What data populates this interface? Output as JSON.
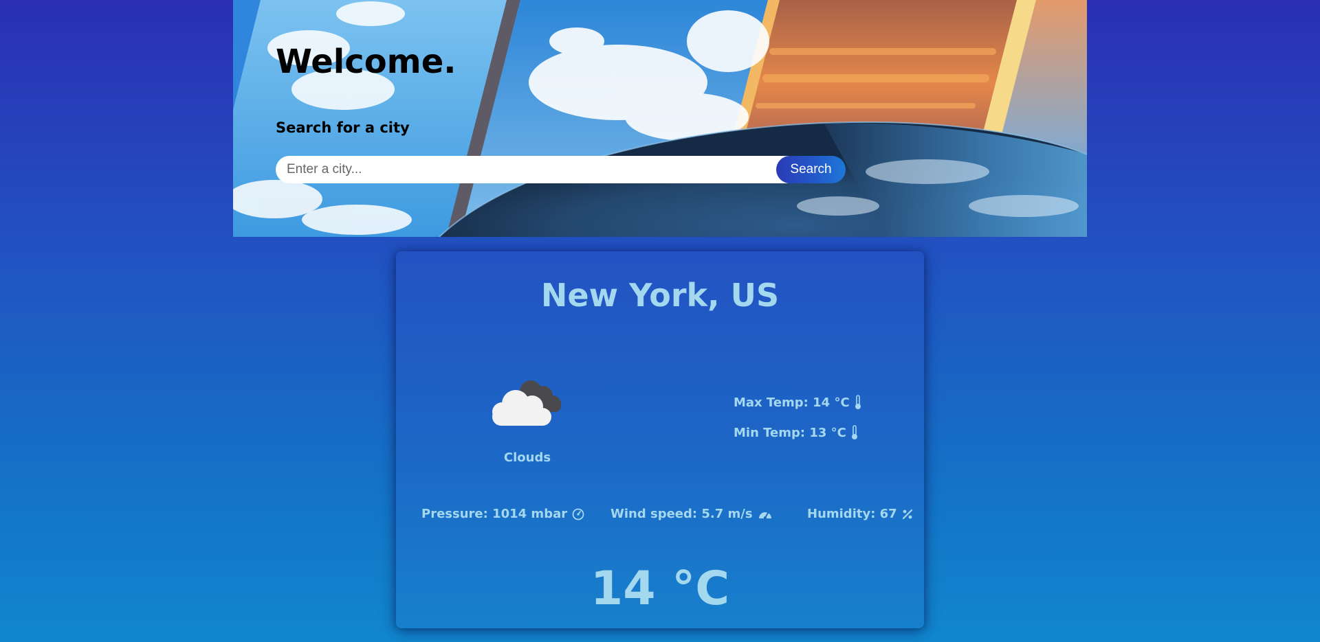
{
  "hero": {
    "welcome": "Welcome.",
    "search_label": "Search for a city",
    "search_placeholder": "Enter a city...",
    "search_value": "",
    "search_button": "Search"
  },
  "weather": {
    "city": "New York, US",
    "condition": "Clouds",
    "condition_icon": "clouds-icon",
    "max_temp": "Max Temp: 14 °C",
    "min_temp": "Min Temp: 13 °C",
    "pressure": "Pressure: 1014 mbar",
    "wind_speed": "Wind speed: 5.7 m/s",
    "humidity": "Humidity: 67",
    "temperature": "14 °C"
  },
  "icons": {
    "max_temp": "thermometer-icon",
    "min_temp": "thermometer-icon",
    "pressure": "gauge-icon",
    "wind_speed": "speedometer-icon",
    "humidity": "percent-icon"
  },
  "colors": {
    "accent_text": "#a4d8ef",
    "button_gradient_start": "#2a3bb5",
    "button_gradient_end": "#1e78d8"
  }
}
